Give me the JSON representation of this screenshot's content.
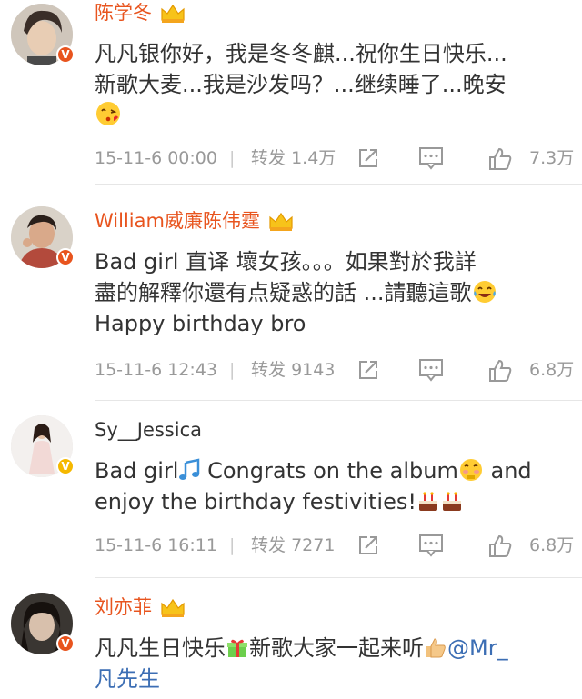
{
  "colors": {
    "vip_name": "#e8541e",
    "meta_gray": "#999999",
    "text": "#333333",
    "mention_blue": "#3c6eb4",
    "badge_red": "#e8541e",
    "badge_gold": "#f5b800"
  },
  "comments": [
    {
      "user": "陈学冬",
      "crown": true,
      "badge": "V",
      "lines": [
        "凡凡银你好，我是冬冬麒...祝你生日快乐...",
        "新歌大麦...我是沙发吗？...继续睡了...晚安"
      ],
      "emoji": "kiss-face-emoji",
      "date": "15-11-6 00:00",
      "repost_label": "转发",
      "repost_count": "1.4万",
      "likes": "7.3万"
    },
    {
      "user": "William威廉陈伟霆",
      "crown": true,
      "badge": "V",
      "lines": [
        "Bad girl 直译 壞女孩。。。如果對於我詳",
        "盡的解釋你還有点疑惑的話 ...請聽這歌",
        "Happy birthday bro"
      ],
      "emoji": "laughing-tears-emoji",
      "date": "15-11-6 12:43",
      "repost_label": "转发",
      "repost_count": "9143",
      "likes": "6.8万"
    },
    {
      "user": "Sy__Jessica",
      "crown": false,
      "badge": "V",
      "line1_a": "Bad girl",
      "line1_b": " Congrats on the album",
      "line1_c": " and",
      "line2": "enjoy the birthday festivities!",
      "emojis": [
        "music-note-emoji",
        "shy-face-emoji",
        "cake-emoji"
      ],
      "date": "15-11-6 16:11",
      "repost_label": "转发",
      "repost_count": "7271",
      "likes": "6.8万"
    },
    {
      "user": "刘亦菲",
      "crown": true,
      "badge": "V",
      "part_a": "凡凡生日快乐",
      "part_b": "新歌大家一起来听",
      "mention": "@Mr_",
      "line2": "凡先生",
      "emojis": [
        "gift-emoji",
        "thumbs-up-emoji"
      ]
    }
  ]
}
